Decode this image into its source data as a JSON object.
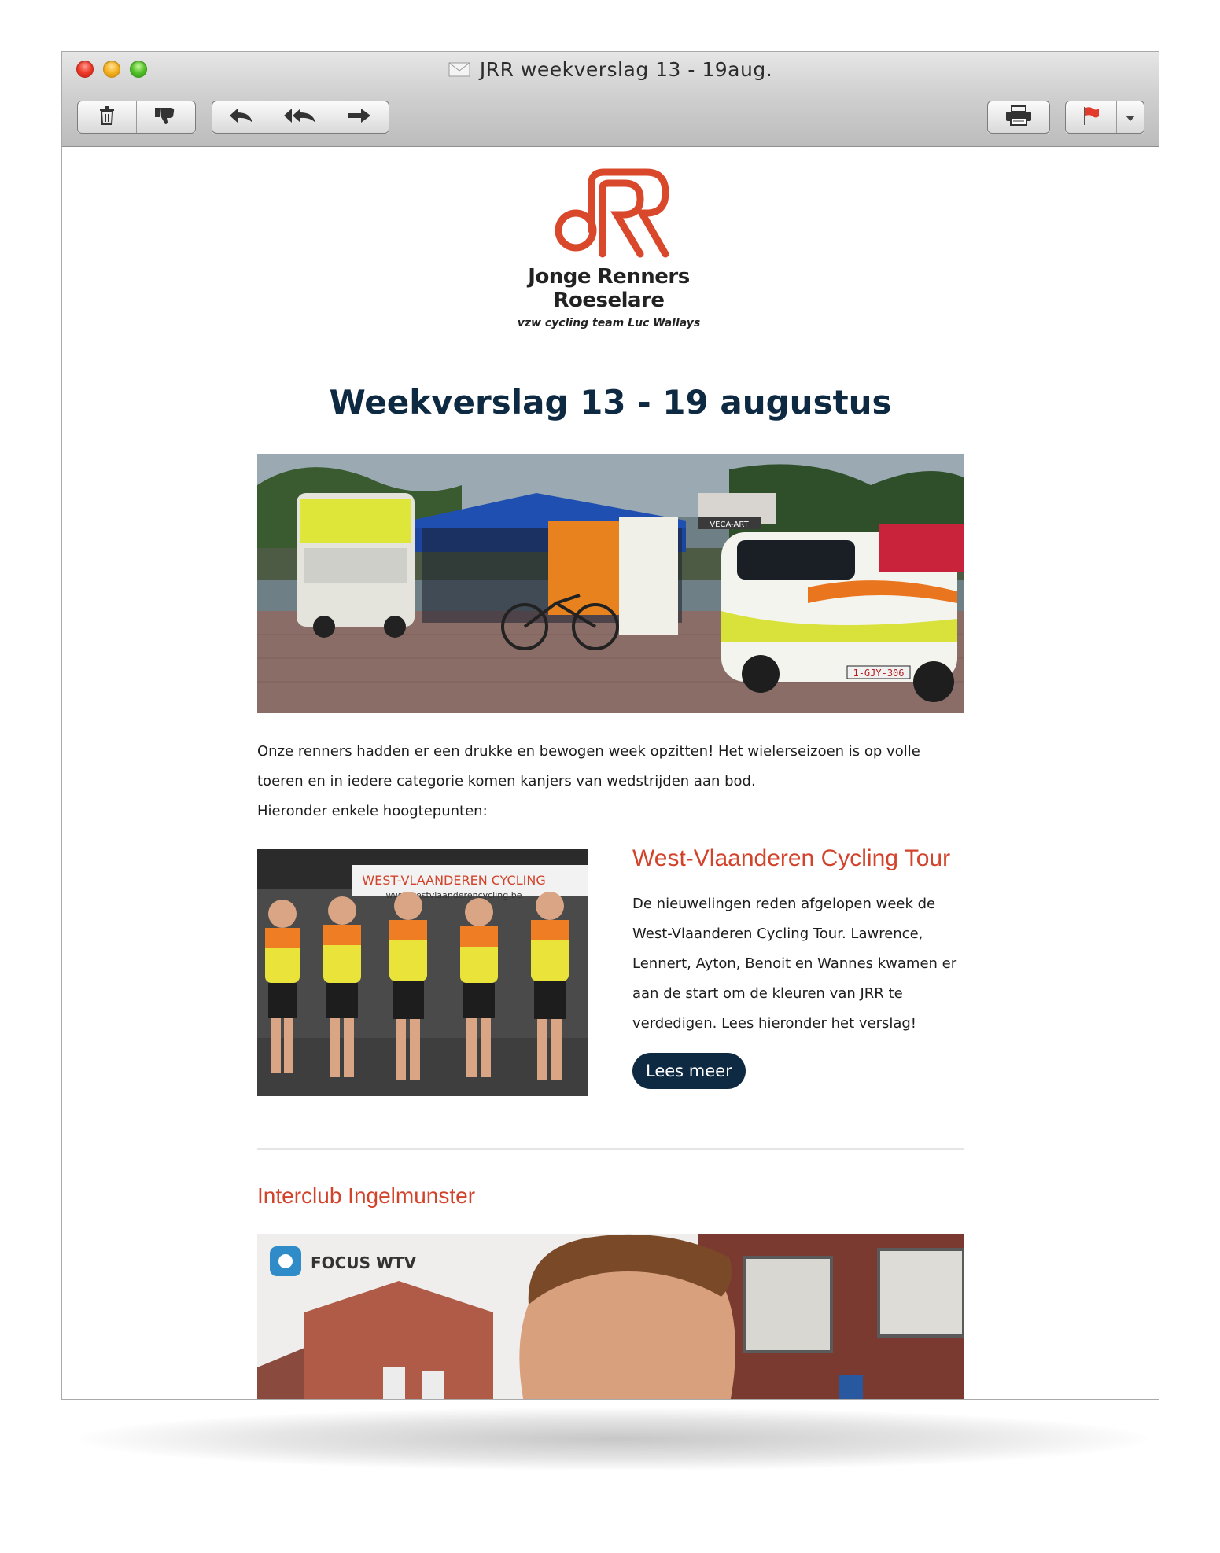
{
  "window": {
    "title": "JRR weekverslag 13 - 19aug.",
    "toolbar": [
      "trash-icon",
      "junk-icon",
      "reply-icon",
      "reply-all-icon",
      "forward-icon",
      "print-icon",
      "flag-icon"
    ]
  },
  "email": {
    "logo": {
      "name": "Jonge Renners Roeselare",
      "tagline": "vzw cycling team Luc Wallays"
    },
    "headline": "Weekverslag 13 - 19 augustus",
    "hero_image": {
      "plate": "1-GJY-306",
      "banner": "VECA-ART"
    },
    "intro": {
      "line1": "Onze renners hadden er een drukke en bewogen week opzitten! Het wielerseizoen is op volle toeren en in iedere categorie komen kanjers van wedstrijden aan bod.",
      "line2": "Hieronder enkele hoogtepunten:"
    },
    "article": {
      "title": "West-Vlaanderen Cycling Tour",
      "body": "De nieuwelingen reden afgelopen week de West-Vlaanderen Cycling Tour. Lawrence, Lennert, Ayton, Benoit en Wannes kwamen er aan de start om de kleuren van JRR te verdedigen. Lees hieronder het verslag!",
      "button": "Lees meer",
      "photo_banner": "WEST-VLAANDEREN CYCLING",
      "photo_url": "www.westvlaanderencycling.be"
    },
    "section2": {
      "title": "Interclub Ingelmunster",
      "photo_logo": "FOCUS WTV"
    }
  },
  "colors": {
    "accent": "#d2432b",
    "navy": "#0e2a42"
  }
}
